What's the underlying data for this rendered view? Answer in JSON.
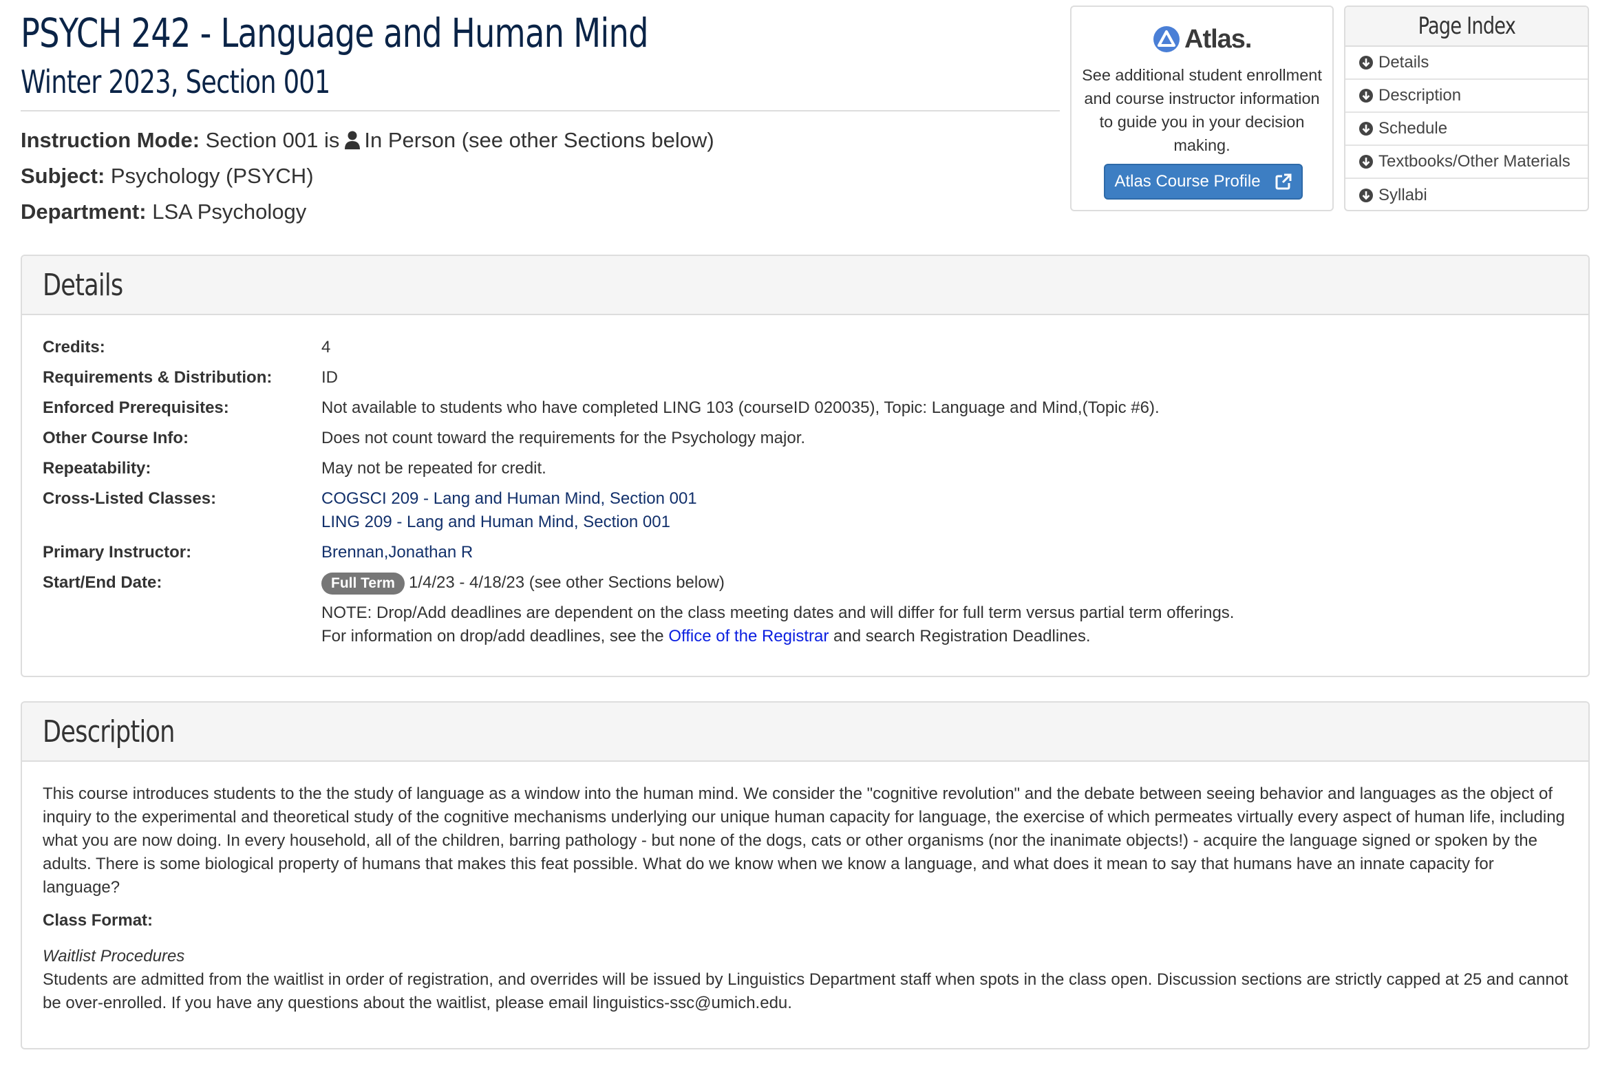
{
  "header": {
    "title": "PSYCH 242 - Language and Human Mind",
    "subtitle": "Winter 2023, Section 001",
    "instruction_mode_label": "Instruction Mode:",
    "instruction_mode_value": "Section 001 is",
    "instruction_mode_tail": "In Person (see other Sections below)",
    "subject_label": "Subject:",
    "subject_value": "Psychology (PSYCH)",
    "department_label": "Department:",
    "department_value": "LSA Psychology"
  },
  "atlas": {
    "logo_text": "Atlas.",
    "description": "See additional student enrollment and course instructor information to guide you in your decision making.",
    "button_label": "Atlas Course Profile",
    "logo_color": "#4a7fd6"
  },
  "page_index": {
    "title": "Page Index",
    "items": [
      "Details",
      "Description",
      "Schedule",
      "Textbooks/Other Materials",
      "Syllabi"
    ]
  },
  "details": {
    "heading": "Details",
    "credits_label": "Credits:",
    "credits_value": "4",
    "requirements_label": "Requirements & Distribution:",
    "requirements_value": "ID",
    "prereq_label": "Enforced Prerequisites:",
    "prereq_value": "Not available to students who have completed LING 103 (courseID 020035), Topic: Language and Mind,(Topic #6).",
    "other_info_label": "Other Course Info:",
    "other_info_value": "Does not count toward the requirements for the Psychology major.",
    "repeatability_label": "Repeatability:",
    "repeatability_value": "May not be repeated for credit.",
    "cross_listed_label": "Cross-Listed Classes:",
    "cross_listed": [
      "COGSCI 209 - Lang and Human Mind, Section 001",
      "LING 209 - Lang and Human Mind, Section 001"
    ],
    "instructor_label": "Primary Instructor:",
    "instructor_value": "Brennan,Jonathan R",
    "dates_label": "Start/End Date:",
    "term_badge": "Full Term",
    "dates_value": "1/4/23 - 4/18/23 (see other Sections below)",
    "note": "NOTE: Drop/Add deadlines are dependent on the class meeting dates and will differ for full term versus partial term offerings.",
    "info_prefix": "For information on drop/add deadlines, see the",
    "registrar_link": "Office of the Registrar",
    "info_suffix": "and search Registration Deadlines."
  },
  "description": {
    "heading": "Description",
    "body": "This course introduces students to the the study of language as a window into the human mind. We consider the \"cognitive revolution\" and the debate between seeing behavior and languages as the object of inquiry to the experimental and theoretical study of the cognitive mechanisms underlying our unique human capacity for language, the exercise of which permeates virtually every aspect of human life, including what you are now doing. In every household, all of the children, barring pathology - but none of the dogs, cats or other organisms (nor the inanimate objects!) - acquire the language signed or spoken by the adults. There is some biological property of humans that makes this feat possible. What do we know when we know a language, and what does it mean to say that humans have an innate capacity for language?",
    "class_format_label": "Class Format:",
    "waitlist_heading": "Waitlist Procedures",
    "waitlist_body": "Students are admitted from the waitlist in order of registration, and overrides will be issued by Linguistics Department staff when spots in the class open. Discussion sections are strictly capped at 25 and cannot be over-enrolled. If you have any questions about the waitlist, please email linguistics-ssc@umich.edu."
  }
}
